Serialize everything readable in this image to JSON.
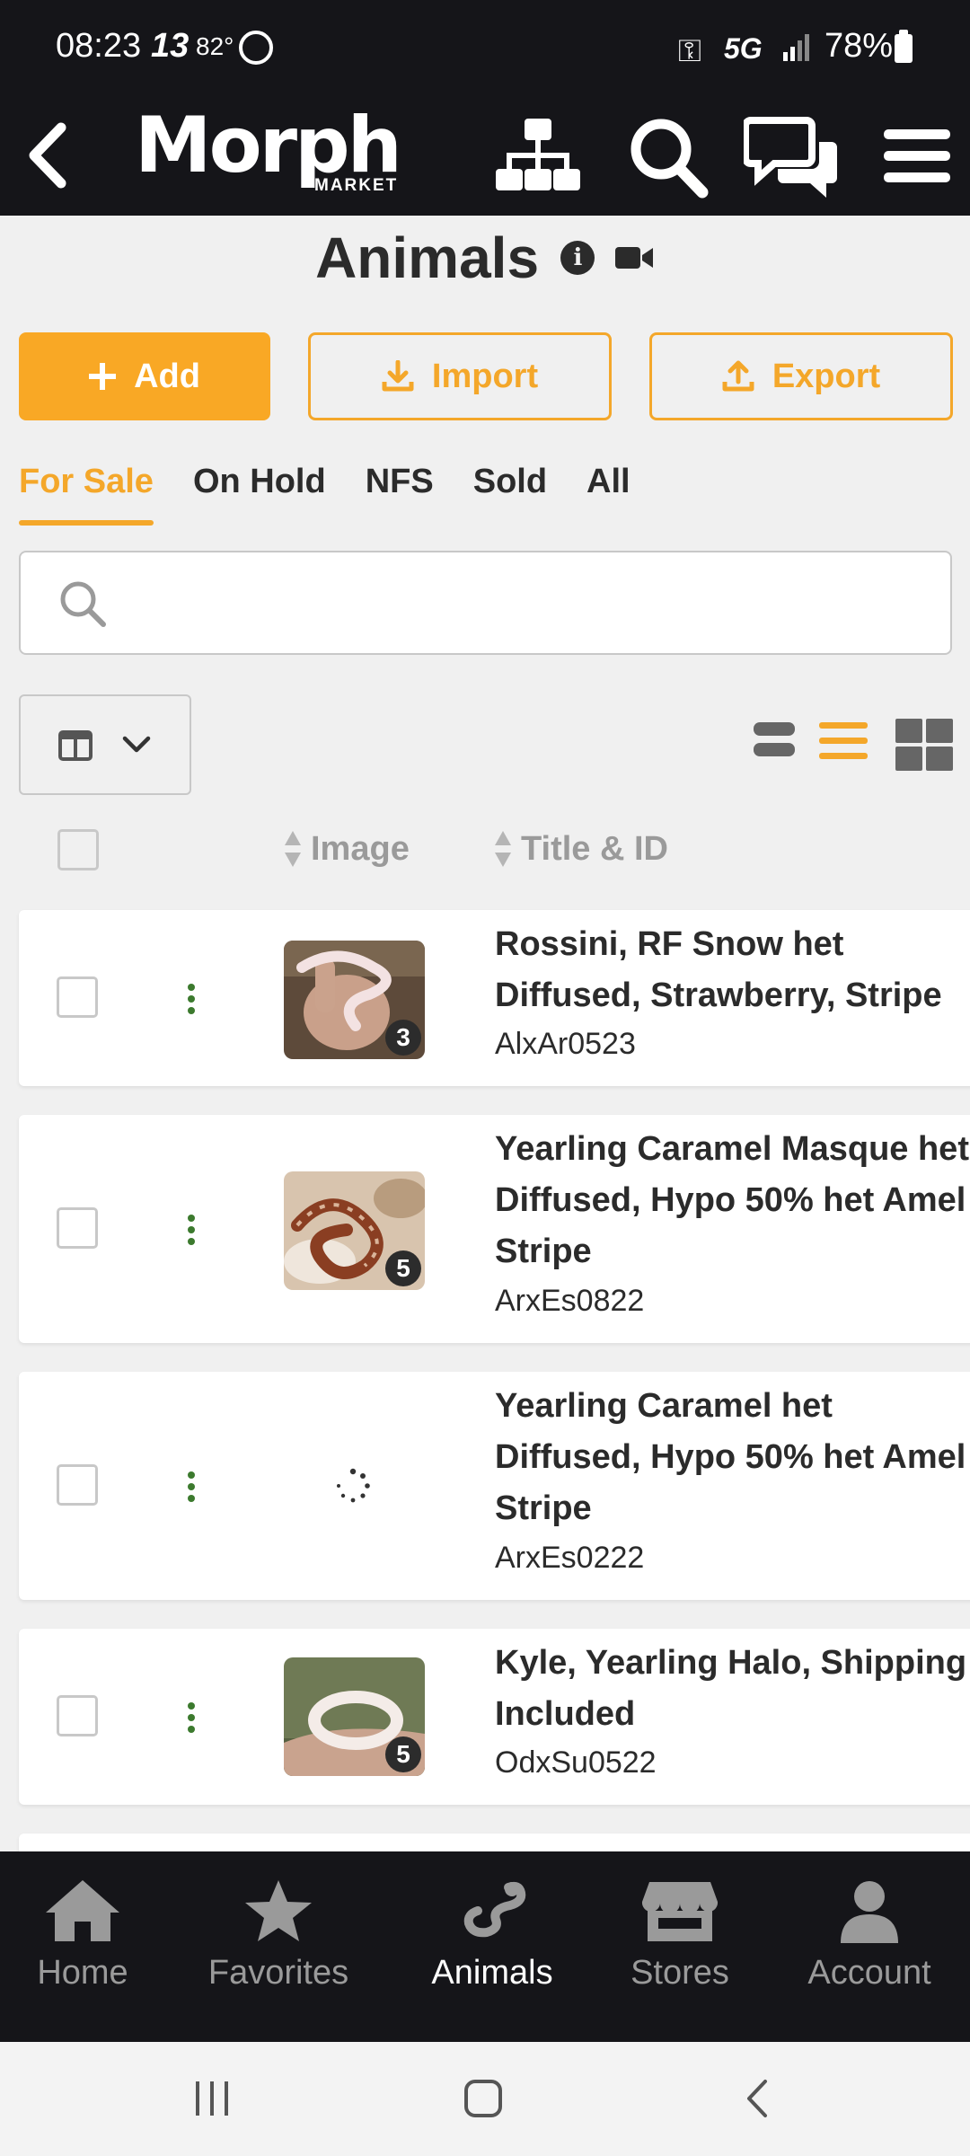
{
  "status_bar": {
    "time": "08:23",
    "notification_number": "13",
    "temperature": "82°",
    "network": "5G",
    "battery": "78%"
  },
  "header": {
    "logo_text": "Morph",
    "logo_subtext": "MARKET",
    "icons": [
      "back-icon",
      "sitemap-icon",
      "search-icon",
      "chat-icon",
      "menu-icon"
    ]
  },
  "page": {
    "title": "Animals"
  },
  "actions": {
    "add_label": "Add",
    "import_label": "Import",
    "export_label": "Export"
  },
  "tabs": [
    {
      "label": "For Sale",
      "active": true
    },
    {
      "label": "On Hold",
      "active": false
    },
    {
      "label": "NFS",
      "active": false
    },
    {
      "label": "Sold",
      "active": false
    },
    {
      "label": "All",
      "active": false
    }
  ],
  "search": {
    "placeholder": ""
  },
  "table": {
    "columns": [
      "Image",
      "Title & ID"
    ],
    "rows": [
      {
        "title_lines": [
          "Rossini, RF Snow het",
          "Diffused, Strawberry, Stripe"
        ],
        "id": "AlxAr0523",
        "image_count": "3",
        "image_loading": false
      },
      {
        "title_lines": [
          "Yearling Caramel Masque het",
          "Diffused, Hypo 50% het Amel",
          "Stripe"
        ],
        "id": "ArxEs0822",
        "image_count": "5",
        "image_loading": false
      },
      {
        "title_lines": [
          "Yearling Caramel het",
          "Diffused, Hypo 50% het Amel",
          "Stripe"
        ],
        "id": "ArxEs0222",
        "image_count": "",
        "image_loading": true
      },
      {
        "title_lines": [
          "Kyle, Yearling Halo, Shipping",
          "Included"
        ],
        "id": "OdxSu0522",
        "image_count": "5",
        "image_loading": false
      }
    ]
  },
  "bottom_nav": [
    {
      "label": "Home",
      "icon": "home-icon",
      "active": false
    },
    {
      "label": "Favorites",
      "icon": "star-icon",
      "active": false
    },
    {
      "label": "Animals",
      "icon": "snake-icon",
      "active": true
    },
    {
      "label": "Stores",
      "icon": "store-icon",
      "active": false
    },
    {
      "label": "Account",
      "icon": "user-icon",
      "active": false
    }
  ],
  "colors": {
    "accent": "#f4a72a",
    "dark_bar": "#151519",
    "menu_dots": "#3c7a2e"
  }
}
